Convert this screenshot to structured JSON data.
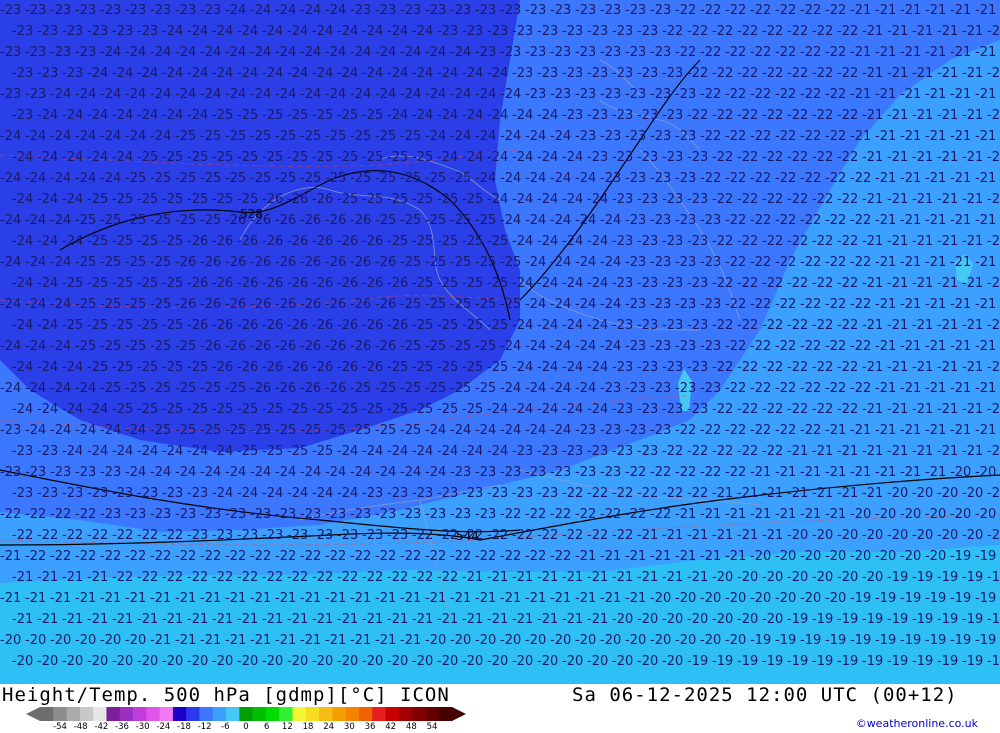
{
  "title_left": "Height/Temp. 500 hPa [gdmp][°C] ICON",
  "title_right": "Sa 06-12-2025 12:00 UTC (00+12)",
  "credit": "©weatheronline.co.uk",
  "colorbar": {
    "labels": [
      "-54",
      "-48",
      "-42",
      "-36",
      "-30",
      "-24",
      "-18",
      "-12",
      "-6",
      "0",
      "6",
      "12",
      "18",
      "24",
      "30",
      "36",
      "42",
      "48",
      "54"
    ],
    "colors": [
      "#6e6e6e",
      "#8c8c8c",
      "#aaaaaa",
      "#c8c8c8",
      "#e6e6e6",
      "#7a1f9a",
      "#9b2fbf",
      "#be3ddb",
      "#e055e8",
      "#f07af5",
      "#1a00c8",
      "#2d39f0",
      "#3c78ff",
      "#3ca0ff",
      "#46c8f5",
      "#00a000",
      "#00be00",
      "#00dc00",
      "#32f032",
      "#f5f532",
      "#f5dc1e",
      "#f5be14",
      "#f5a000",
      "#f58200",
      "#f06400",
      "#e61e1e",
      "#c80000",
      "#a00000",
      "#820000",
      "#640000",
      "#460000"
    ]
  },
  "map": {
    "field_colors": {
      "deep": "#2b3fe8",
      "mid": "#3c78ff",
      "light": "#3ca0ff",
      "cyan": "#2ec0f5"
    },
    "contour_labels": [
      "-26",
      "-25",
      "-24",
      "-23",
      "-22",
      "-21",
      "-20",
      "-19"
    ],
    "height_labels": [
      "528",
      "544"
    ]
  }
}
